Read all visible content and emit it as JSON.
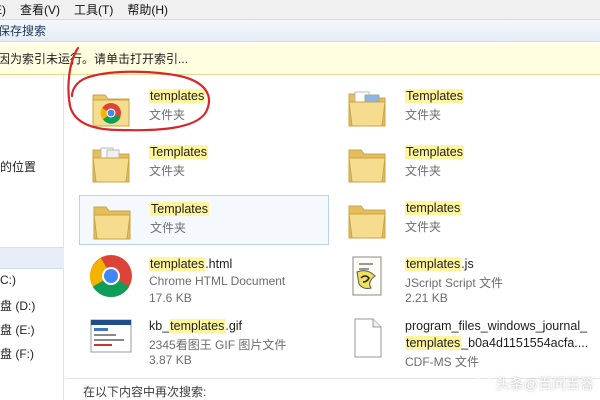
{
  "menubar": {
    "items": [
      "E)",
      "查看(V)",
      "工具(T)",
      "帮助(H)"
    ]
  },
  "savebar": {
    "label": "保存搜索"
  },
  "infobar": {
    "text": "因为索引未运行。请单击打开索引..."
  },
  "navpane": {
    "items": [
      "的位置",
      "C:)",
      "盘 (D:)",
      "盘 (E:)",
      "盘 (F:)"
    ]
  },
  "results": [
    {
      "name_hl": "templates",
      "name_rest": "",
      "type": "文件夹",
      "icon": "chrome-folder-icon"
    },
    {
      "name_hl": "Templates",
      "name_rest": "",
      "type": "文件夹",
      "icon": "folder-icon"
    },
    {
      "name_hl": "Templates",
      "name_rest": "",
      "type": "文件夹",
      "icon": "folder-icon"
    },
    {
      "name_hl": "Templates",
      "name_rest": "",
      "type": "文件夹",
      "icon": "folder-icon"
    },
    {
      "name_hl": "Templates",
      "name_rest": "",
      "type": "文件夹",
      "icon": "folder-icon"
    },
    {
      "name_hl": "templates",
      "name_rest": "",
      "type": "文件夹",
      "icon": "folder-icon"
    },
    {
      "name_hl": "templates",
      "name_rest": ".html",
      "type": "Chrome HTML Document",
      "size": "17.6 KB",
      "icon": "chrome-icon"
    },
    {
      "name_hl": "templates",
      "name_rest": ".js",
      "type": "JScript Script 文件",
      "size": "2.21 KB",
      "icon": "jscript-icon"
    },
    {
      "name_pre": "kb_",
      "name_hl": "templates",
      "name_rest": ".gif",
      "type": "2345看图王 GIF 图片文件",
      "size": "3.87 KB",
      "icon": "gif-image-icon"
    },
    {
      "name_line1": "program_files_windows_journal_",
      "name_hl": "templates",
      "name_rest": "_b0a4d1151554acfa....",
      "type": "CDF-MS 文件",
      "icon": "document-icon"
    }
  ],
  "footer": {
    "search_again": "在以下内容中再次搜索:"
  },
  "watermark": {
    "text": "头条@百问百答"
  },
  "colors": {
    "highlight": "#fff59d",
    "annotation": "#d6282b",
    "infobar_bg": "#fffee1"
  }
}
